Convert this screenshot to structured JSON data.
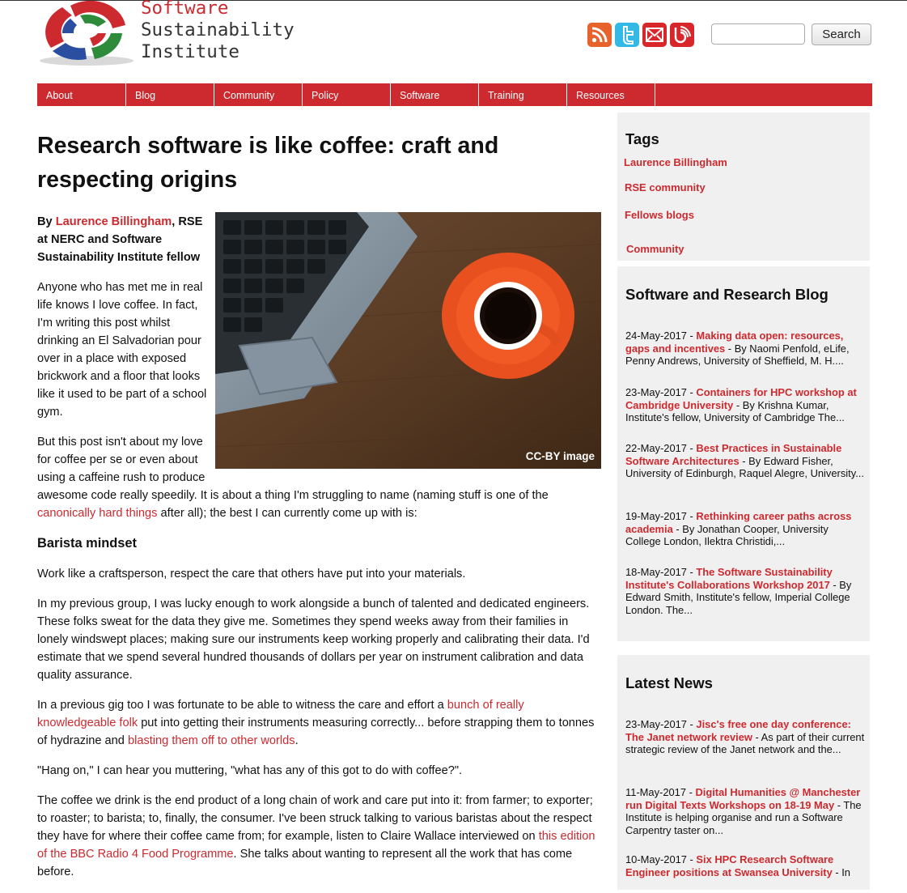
{
  "header": {
    "logo_line1": "Software",
    "logo_line2": "Sustainability",
    "logo_line3": "Institute",
    "social_icons": [
      "rss-icon",
      "twitter-icon",
      "email-icon",
      "blog-icon"
    ],
    "search_placeholder": "",
    "search_button": "Search"
  },
  "nav": [
    "About",
    "Blog",
    "Community",
    "Policy",
    "Software",
    "Training",
    "Resources"
  ],
  "article": {
    "title": "Research software is like coffee: craft and respecting origins",
    "byline_prefix": "By ",
    "byline_author": "Laurence Billingham",
    "byline_suffix": ", RSE at NERC and Software Sustainability Institute fellow",
    "image_caption": "CC-BY image",
    "p1": "Anyone who has met me in real life knows I love coffee. In fact, I'm writing this post whilst drinking an El Salvadorian pour over in a place with exposed brickwork and a floor that looks like it used to be part of a school gym.",
    "p2_a": "But this post isn't about my love for coffee per se or even about using a caffeine rush to produce awesome code really speedily. It is about a thing I'm struggling to name (naming stuff is one of the ",
    "p2_link": "canonically hard things",
    "p2_b": " after all); the best I can currently come up with is:",
    "h3": "Barista mindset",
    "p3": "Work like a craftsperson, respect the care that others have put into your materials.",
    "p4": "In my previous group, I was lucky enough to work alongside a bunch of talented and dedicated engineers. These folks sweat for the data they give me. Sometimes they spend weeks away from their families in lonely windswept places; making sure our instruments keep working properly and calibrating their data. I'd estimate that we spend several hundred thousands of dollars per year on instrument calibration and data quality assurance.",
    "p5_a": "In a previous gig too I was fortunate to be able to witness the care and effort a ",
    "p5_link1": "bunch of really knowledgeable folk",
    "p5_b": " put into getting their instruments measuring correctly... before strapping them to tonnes of hydrazine and ",
    "p5_link2": "blasting them off to other worlds",
    "p5_c": ".",
    "p6": "\"Hang on,\" I can hear you muttering, \"what has any of this got to do with coffee?\".",
    "p7_a": "The coffee we drink is the end product of a long chain of work and care put into it: from farmer; to exporter; to roaster; to barista; to, finally, the consumer. I've been struck talking to various baristas about the respect they have for where their coffee came from; for example, listen to Claire Wallace interviewed on ",
    "p7_link": "this edition of the BBC Radio 4 Food Programme",
    "p7_b": ". She talks about wanting to represent all the work that has come before."
  },
  "sidebar": {
    "tags_title": "Tags",
    "tags": [
      "Laurence Billingham",
      "RSE community",
      "Fellows blogs",
      "Community"
    ],
    "blog_title": "Software and Research Blog",
    "blog_entries": [
      {
        "date": "24-May-2017 - ",
        "title": "Making data open: resources, gaps and incentives",
        "sep": " - ",
        "summary": " By Naomi Penfold, eLife, Penny Andrews, University of Sheffield, M. H...."
      },
      {
        "date": "23-May-2017 - ",
        "title": "Containers for HPC workshop at Cambridge University",
        "sep": " - ",
        "summary": " By Krishna Kumar, Institute's fellow, University of Cambridge The..."
      },
      {
        "date": "22-May-2017 - ",
        "title": "Best Practices in Sustainable Software Architectures",
        "sep": " - ",
        "summary": " By Edward Fisher, University of Edinburgh, Raquel Alegre, University..."
      },
      {
        "date": "19-May-2017 - ",
        "title": "Rethinking career paths across academia",
        "sep": " - ",
        "summary": " By Jonathan Cooper, University College London, Ilektra Christidi,..."
      },
      {
        "date": "18-May-2017 - ",
        "title": "The Software Sustainability Institute's Collaborations Workshop 2017",
        "sep": " - ",
        "summary": " By Edward Smith, Institute's fellow, Imperial College London. The..."
      }
    ],
    "news_title": "Latest News",
    "news_entries": [
      {
        "date": "23-May-2017 - ",
        "title": "Jisc's free one day conference: The Janet network review",
        "sep": " - ",
        "summary": " As part of their current strategic review of the Janet network and the..."
      },
      {
        "date": "11-May-2017 - ",
        "title": "Digital Humanities @ Manchester run Digital Texts Workshops on 18-19 May",
        "sep": " - ",
        "summary": " The Institute is helping organise and run a Software Carpentry taster on..."
      },
      {
        "date": "10-May-2017 - ",
        "title": "Six HPC Research Software Engineer positions at Swansea University",
        "sep": " - ",
        "summary": " In"
      }
    ]
  },
  "colors": {
    "brand_red": "#cc2a2f",
    "sidebar_bg": "#f0f0f0",
    "social_orange": "#e8622b",
    "social_blue": "#33b9e6"
  }
}
